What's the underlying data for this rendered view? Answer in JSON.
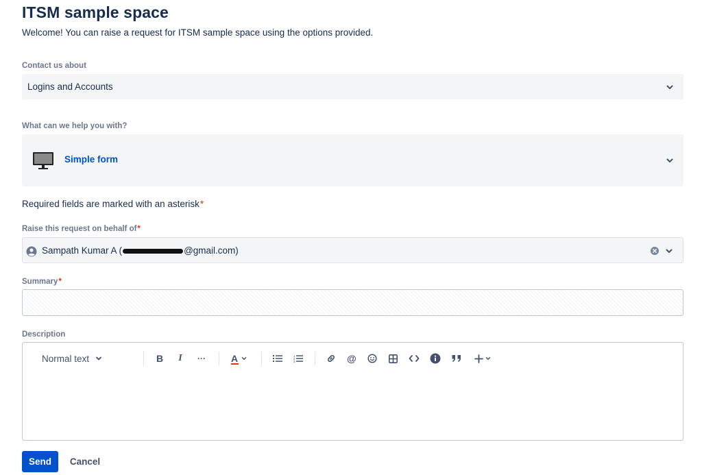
{
  "header": {
    "title": "ITSM sample space",
    "subtitle": "Welcome! You can raise a request for ITSM sample space using the options provided."
  },
  "contact": {
    "label": "Contact us about",
    "value": "Logins and Accounts"
  },
  "help": {
    "label": "What can we help you with?",
    "value": "Simple form",
    "icon": "monitor-icon"
  },
  "form": {
    "required_note": "Required fields are marked with an asterisk",
    "asterisk": "*",
    "behalf": {
      "label": "Raise this request on behalf of",
      "name": "Sampath Kumar A (",
      "email_suffix": "@gmail.com)"
    },
    "summary": {
      "label": "Summary",
      "value": ""
    },
    "description": {
      "label": "Description",
      "toolbar": {
        "text_style": "Normal text",
        "bold": "B",
        "italic": "I",
        "more": "···",
        "text_color": "A"
      }
    }
  },
  "actions": {
    "send": "Send",
    "cancel": "Cancel"
  },
  "colors": {
    "primary": "#0052cc",
    "required": "#de350b",
    "field_bg": "#f4f5f7",
    "text": "#172b4d"
  }
}
